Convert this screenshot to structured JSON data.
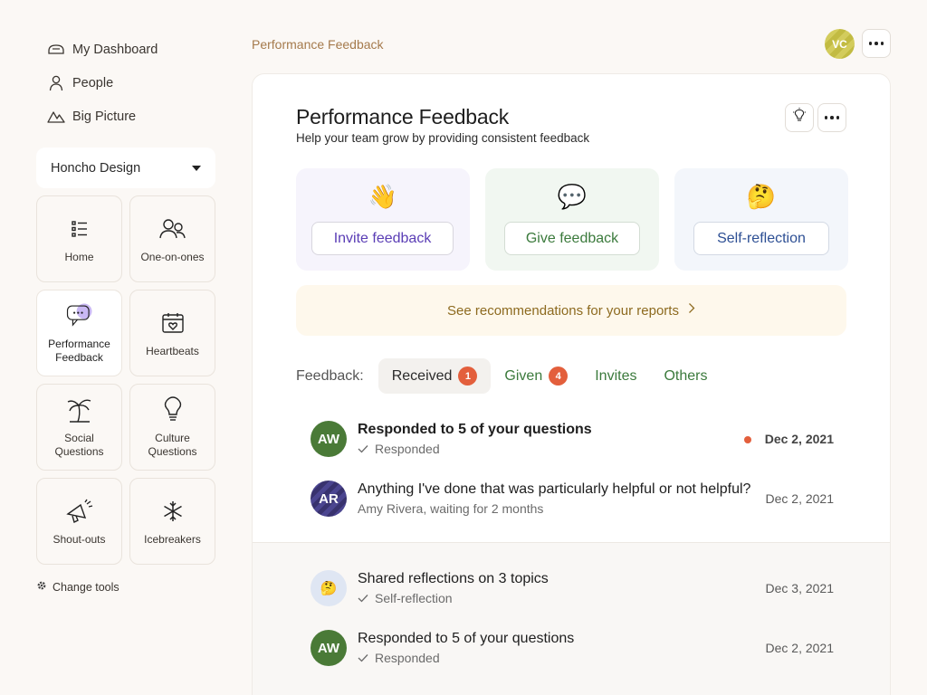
{
  "nav": {
    "items": [
      {
        "label": "My Dashboard",
        "icon": "dashboard-icon"
      },
      {
        "label": "People",
        "icon": "person-icon"
      },
      {
        "label": "Big Picture",
        "icon": "mountain-icon"
      }
    ]
  },
  "workspace": {
    "name": "Honcho Design"
  },
  "tools": [
    {
      "label": "Home",
      "icon": "list-icon"
    },
    {
      "label": "One-on-ones",
      "icon": "people-icon"
    },
    {
      "label": "Performance Feedback",
      "icon": "chat-bubble-icon",
      "active": true
    },
    {
      "label": "Heartbeats",
      "icon": "calendar-heart-icon"
    },
    {
      "label": "Social Questions",
      "icon": "palm-tree-icon"
    },
    {
      "label": "Culture Questions",
      "icon": "lightbulb-icon"
    },
    {
      "label": "Shout-outs",
      "icon": "megaphone-icon"
    },
    {
      "label": "Icebreakers",
      "icon": "snowflake-icon"
    }
  ],
  "change_tools": "Change tools",
  "header": {
    "breadcrumb": "Performance Feedback",
    "user_initials": "VC"
  },
  "page": {
    "title": "Performance Feedback",
    "subtitle": "Help your team grow by providing consistent feedback"
  },
  "actions": {
    "invite": {
      "emoji": "👋",
      "label": "Invite feedback"
    },
    "give": {
      "emoji": "💬",
      "label": "Give feedback"
    },
    "self": {
      "emoji": "🤔",
      "label": "Self-reflection"
    }
  },
  "recommendations": "See recommendations for your reports",
  "tabs": {
    "prefix": "Feedback:",
    "items": [
      {
        "label": "Received",
        "badge": "1",
        "active": true
      },
      {
        "label": "Given",
        "badge": "4"
      },
      {
        "label": "Invites"
      },
      {
        "label": "Others"
      }
    ]
  },
  "feedback_items": [
    {
      "initials": "AW",
      "title": "Responded to 5 of your questions",
      "meta": "Responded",
      "date": "Dec 2, 2021",
      "unread": true
    },
    {
      "initials": "AR",
      "title": "Anything I've done that was particularly helpful or not helpful?",
      "meta": "Amy Rivera, waiting for 2 months",
      "date": "Dec 2, 2021"
    }
  ],
  "past_items": [
    {
      "initials": "🤔",
      "title": "Shared reflections on 3 topics",
      "meta": "Self-reflection",
      "date": "Dec 3, 2021"
    },
    {
      "initials": "AW",
      "title": "Responded to 5 of your questions",
      "meta": "Responded",
      "date": "Dec 2, 2021"
    }
  ],
  "colors": {
    "background": "#fbf8f5",
    "accent_green": "#3b7a3c",
    "accent_purple": "#5a3db5",
    "accent_blue": "#2d4f94",
    "badge": "#e35f3c",
    "breadcrumb": "#a57a4c"
  }
}
